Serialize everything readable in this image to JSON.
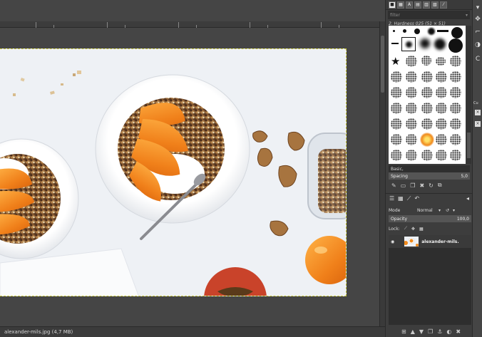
{
  "status_bar": {
    "file_info": "alexander-mils.jpg (4,7 MB)"
  },
  "brushes_panel": {
    "filter_placeholder": "filter",
    "brush_name": "2. Hardness 025 (51 × 51)",
    "tag_value": "Basic,",
    "spacing_label": "Spacing",
    "spacing_value": "5,0"
  },
  "layers_panel": {
    "mode_label": "Mode",
    "mode_value": "Normal",
    "opacity_label": "Opacity",
    "opacity_value": "100,0",
    "lock_label": "Lock:",
    "layer_name": "alexander-mils."
  },
  "far_right": {
    "cut_label": "Cu"
  },
  "colors": {
    "window_bg": "#454545",
    "dock_bg": "#3d3d3d",
    "image_bg": "#eef1f5",
    "peach": "#f08a1c",
    "selection_border": "#c8c83c"
  }
}
